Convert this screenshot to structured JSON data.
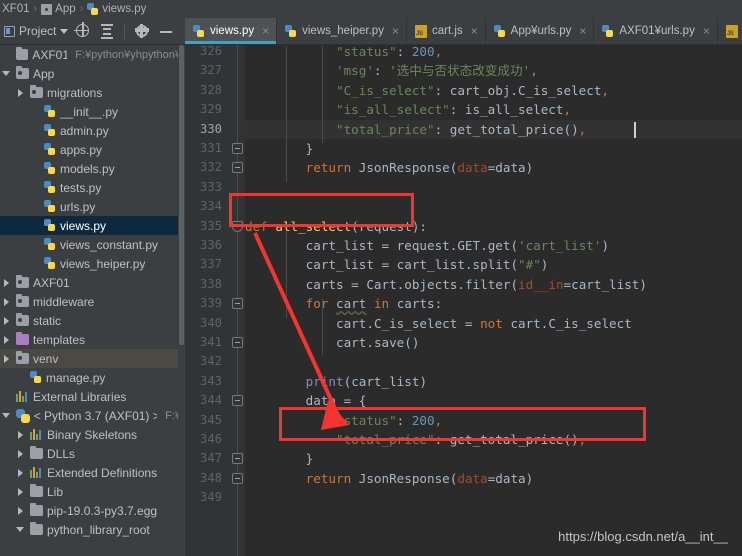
{
  "breadcrumb": {
    "items": [
      {
        "label": "XF01",
        "icon": "none"
      },
      {
        "label": "App",
        "icon": "module-icon"
      },
      {
        "label": "views.py",
        "icon": "python-file-icon"
      }
    ],
    "separator": "›"
  },
  "toolbar": {
    "project_label": "Project",
    "buttons": [
      {
        "name": "locate-in-tree-button",
        "icon": "target-icon"
      },
      {
        "name": "collapse-all-button",
        "icon": "collapse-all-icon"
      },
      {
        "name": "settings-button",
        "icon": "gear-icon"
      },
      {
        "name": "hide-panel-button",
        "icon": "minimize-icon"
      }
    ]
  },
  "tabs": [
    {
      "label": "views.py",
      "icon": "python-file-icon",
      "active": true,
      "close": "×"
    },
    {
      "label": "views_heiper.py",
      "icon": "python-file-icon",
      "active": false,
      "close": "×"
    },
    {
      "label": "cart.js",
      "icon": "js-file-icon",
      "active": false,
      "close": "×"
    },
    {
      "label": "App¥urls.py",
      "icon": "python-file-icon",
      "active": false,
      "close": "×"
    },
    {
      "label": "AXF01¥urls.py",
      "icon": "python-file-icon",
      "active": false,
      "close": "×"
    }
  ],
  "tree": {
    "nodes": [
      {
        "label": "AXF01",
        "sub": "F:¥python¥yhpython¥",
        "icon": "folder-icon",
        "indent": 0,
        "arrow": "none",
        "state": "normal"
      },
      {
        "label": "App",
        "sub": "",
        "icon": "source-folder-icon",
        "indent": 0,
        "arrow": "open",
        "state": "normal"
      },
      {
        "label": "migrations",
        "sub": "",
        "icon": "source-folder-icon",
        "indent": 1,
        "arrow": "closed",
        "state": "normal"
      },
      {
        "label": "__init__.py",
        "sub": "",
        "icon": "python-file-icon",
        "indent": 2,
        "arrow": "none",
        "state": "normal"
      },
      {
        "label": "admin.py",
        "sub": "",
        "icon": "python-file-icon",
        "indent": 2,
        "arrow": "none",
        "state": "normal"
      },
      {
        "label": "apps.py",
        "sub": "",
        "icon": "python-file-icon",
        "indent": 2,
        "arrow": "none",
        "state": "normal"
      },
      {
        "label": "models.py",
        "sub": "",
        "icon": "python-file-icon",
        "indent": 2,
        "arrow": "none",
        "state": "normal"
      },
      {
        "label": "tests.py",
        "sub": "",
        "icon": "python-file-icon",
        "indent": 2,
        "arrow": "none",
        "state": "normal"
      },
      {
        "label": "urls.py",
        "sub": "",
        "icon": "python-file-icon",
        "indent": 2,
        "arrow": "none",
        "state": "normal"
      },
      {
        "label": "views.py",
        "sub": "",
        "icon": "python-file-icon",
        "indent": 2,
        "arrow": "none",
        "state": "selected"
      },
      {
        "label": "views_constant.py",
        "sub": "",
        "icon": "python-file-icon",
        "indent": 2,
        "arrow": "none",
        "state": "normal"
      },
      {
        "label": "views_heiper.py",
        "sub": "",
        "icon": "python-file-icon",
        "indent": 2,
        "arrow": "none",
        "state": "normal"
      },
      {
        "label": "AXF01",
        "sub": "",
        "icon": "source-folder-icon",
        "indent": 0,
        "arrow": "closed",
        "state": "normal"
      },
      {
        "label": "middleware",
        "sub": "",
        "icon": "source-folder-icon",
        "indent": 0,
        "arrow": "closed",
        "state": "normal"
      },
      {
        "label": "static",
        "sub": "",
        "icon": "source-folder-icon",
        "indent": 0,
        "arrow": "closed",
        "state": "normal"
      },
      {
        "label": "templates",
        "sub": "",
        "icon": "template-folder-icon",
        "indent": 0,
        "arrow": "closed",
        "state": "normal"
      },
      {
        "label": "venv",
        "sub": "",
        "icon": "source-folder-icon",
        "indent": 0,
        "arrow": "closed",
        "state": "hover"
      },
      {
        "label": "manage.py",
        "sub": "",
        "icon": "python-file-icon",
        "indent": 1,
        "arrow": "none",
        "state": "normal"
      },
      {
        "label": "External Libraries",
        "sub": "",
        "icon": "library-icon",
        "indent": 0,
        "arrow": "none",
        "state": "normal"
      },
      {
        "label": "< Python 3.7 (AXF01) >",
        "sub": "F:¥",
        "icon": "python-interpreter-icon",
        "indent": 0,
        "arrow": "open",
        "state": "normal"
      },
      {
        "label": "Binary Skeletons",
        "sub": "",
        "icon": "library-icon",
        "indent": 1,
        "arrow": "closed",
        "state": "normal"
      },
      {
        "label": "DLLs",
        "sub": "",
        "icon": "plain-folder-icon",
        "indent": 1,
        "arrow": "closed",
        "state": "normal"
      },
      {
        "label": "Extended Definitions",
        "sub": "",
        "icon": "library-icon",
        "indent": 1,
        "arrow": "closed",
        "state": "normal"
      },
      {
        "label": "Lib",
        "sub": "",
        "icon": "plain-folder-icon",
        "indent": 1,
        "arrow": "closed",
        "state": "normal"
      },
      {
        "label": "pip-19.0.3-py3.7.egg",
        "sub": "",
        "icon": "plain-folder-icon",
        "indent": 1,
        "arrow": "closed",
        "state": "normal"
      },
      {
        "label": "python_library_root",
        "sub": "",
        "icon": "plain-folder-icon",
        "indent": 1,
        "arrow": "open",
        "state": "normal"
      }
    ]
  },
  "editor": {
    "first_line_number": 326,
    "last_line_number": 349,
    "current_line_number": 330,
    "lines": [
      {
        "n": 326,
        "text": "            \"status\": 200,"
      },
      {
        "n": 327,
        "text": "            'msg': '选中与否状态改变成功',"
      },
      {
        "n": 328,
        "text": "            \"C_is_select\": cart_obj.C_is_select,"
      },
      {
        "n": 329,
        "text": "            \"is_all_select\": is_all_select,"
      },
      {
        "n": 330,
        "text": "            \"total_price\": get_total_price(),"
      },
      {
        "n": 331,
        "text": "        }"
      },
      {
        "n": 332,
        "text": "        return JsonResponse(data=data)"
      },
      {
        "n": 333,
        "text": ""
      },
      {
        "n": 334,
        "text": ""
      },
      {
        "n": 335,
        "text": "def all_select(request):"
      },
      {
        "n": 336,
        "text": "        cart_list = request.GET.get('cart_list')"
      },
      {
        "n": 337,
        "text": "        cart_list = cart_list.split(\"#\")"
      },
      {
        "n": 338,
        "text": "        carts = Cart.objects.filter(id__in=cart_list)"
      },
      {
        "n": 339,
        "text": "        for cart in carts:"
      },
      {
        "n": 340,
        "text": "            cart.C_is_select = not cart.C_is_select"
      },
      {
        "n": 341,
        "text": "            cart.save()"
      },
      {
        "n": 342,
        "text": ""
      },
      {
        "n": 343,
        "text": "        print(cart_list)"
      },
      {
        "n": 344,
        "text": "        data = {"
      },
      {
        "n": 345,
        "text": "            \"status\": 200,"
      },
      {
        "n": 346,
        "text": "            \"total_price\": get_total_price(),"
      },
      {
        "n": 347,
        "text": "        }"
      },
      {
        "n": 348,
        "text": "        return JsonResponse(data=data)"
      },
      {
        "n": 349,
        "text": ""
      }
    ]
  },
  "annotations": {
    "highlight_boxes": [
      {
        "name": "def-all-select-highlight",
        "target_line": 335,
        "color": "#f5332f"
      },
      {
        "name": "total-price-highlight",
        "target_line": 346,
        "color": "#f5332f"
      }
    ],
    "arrow": {
      "name": "red-annotation-arrow",
      "from_line": 335,
      "to_line": 346,
      "color": "#f5332f"
    }
  },
  "watermark": {
    "text": "https://blog.csdn.net/a__int__"
  },
  "colors": {
    "editor_bg": "#2b2b2b",
    "panel_bg": "#3c3f41",
    "gutter_bg": "#313335",
    "selection_bg": "#0d293e",
    "active_tab_underline": "#3ea2c8",
    "keyword": "#cc7832",
    "string": "#6a8759",
    "number": "#6897bb",
    "function": "#ffc66d",
    "default_text": "#a9b7c6",
    "annotation_red": "#f5332f"
  }
}
